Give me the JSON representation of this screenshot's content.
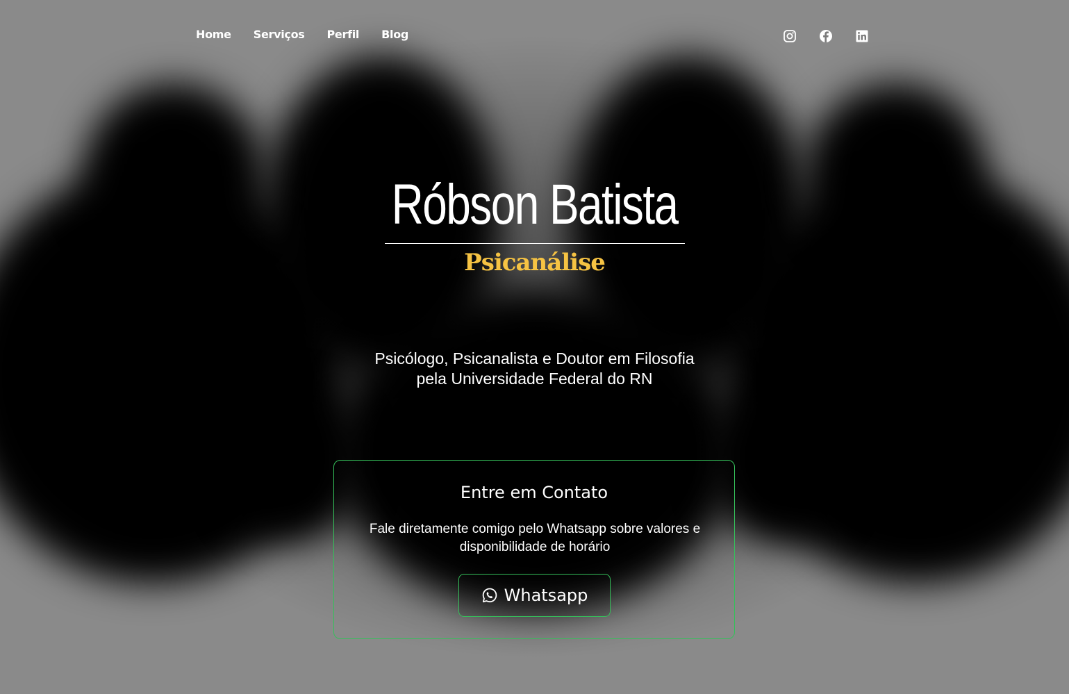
{
  "nav": {
    "items": [
      {
        "label": "Home"
      },
      {
        "label": "Serviços"
      },
      {
        "label": "Perfil"
      },
      {
        "label": "Blog"
      }
    ]
  },
  "social": [
    {
      "icon": "instagram-icon"
    },
    {
      "icon": "facebook-icon"
    },
    {
      "icon": "linkedin-icon"
    }
  ],
  "hero": {
    "title": "Róbson Batista",
    "subtitle": "Psicanálise",
    "description_line1": "Psicólogo, Psicanalista e Doutor em Filosofia",
    "description_line2": "pela Universidade Federal do RN"
  },
  "contact": {
    "title": "Entre em Contato",
    "text_line1": "Fale diretamente comigo pelo Whatsapp sobre valores e",
    "text_line2": "disponibilidade de horário",
    "button_label": "Whatsapp",
    "button_icon": "whatsapp-icon"
  },
  "colors": {
    "accent": "#f6c343",
    "border": "#35c05a",
    "text": "#ffffff"
  }
}
